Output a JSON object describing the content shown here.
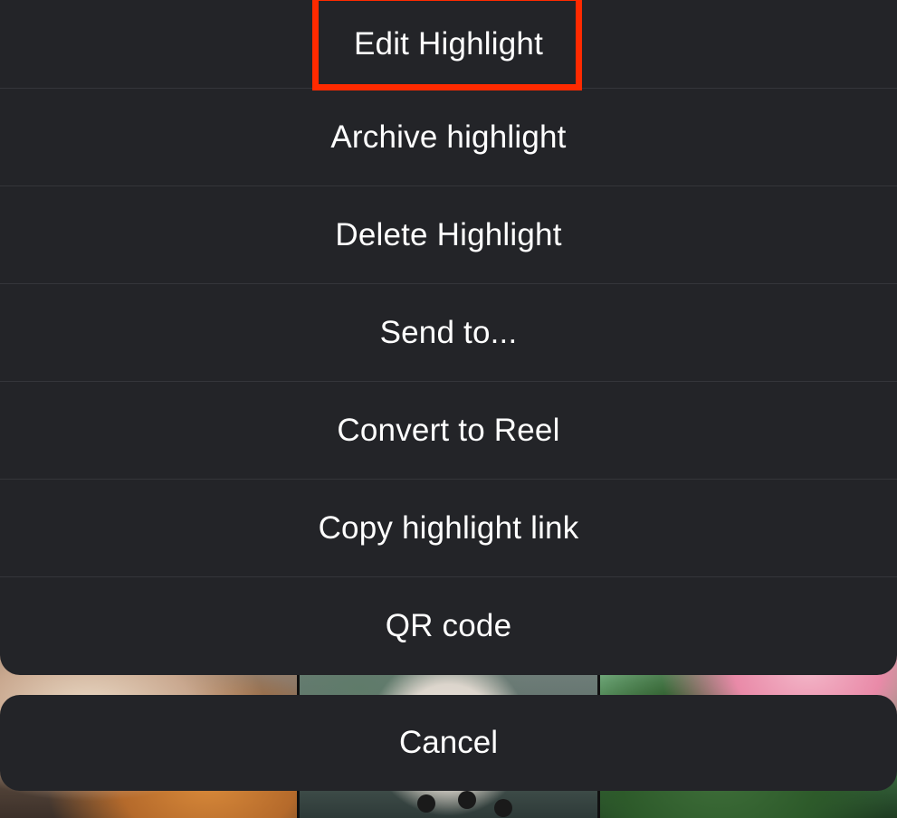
{
  "action_sheet": {
    "items": [
      {
        "label": "Edit Highlight"
      },
      {
        "label": "Archive highlight"
      },
      {
        "label": "Delete Highlight"
      },
      {
        "label": "Send to..."
      },
      {
        "label": "Convert to Reel"
      },
      {
        "label": "Copy highlight link"
      },
      {
        "label": "QR code"
      }
    ]
  },
  "cancel": {
    "label": "Cancel"
  },
  "colors": {
    "sheet_background": "#232428",
    "separator": "#34353a",
    "text": "#ffffff",
    "annotation_box": "#ff2a00"
  }
}
